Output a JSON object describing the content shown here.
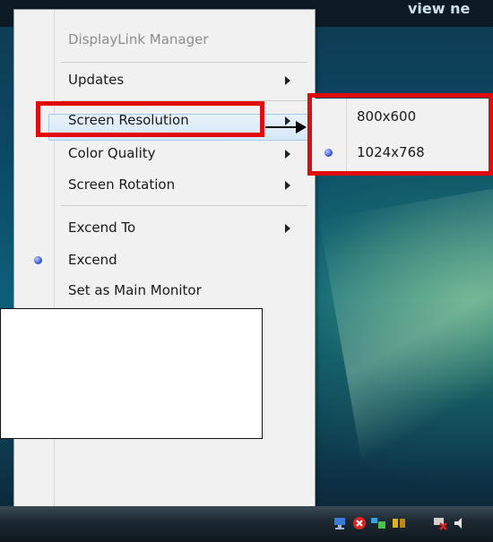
{
  "desktop": {
    "header_text": "view ne"
  },
  "menu": {
    "title": "DisplayLink Manager",
    "items": [
      {
        "label": "Updates",
        "has_submenu": true
      },
      {
        "label": "Screen Resolution",
        "has_submenu": true
      },
      {
        "label": "Color Quality",
        "has_submenu": true
      },
      {
        "label": "Screen Rotation",
        "has_submenu": true
      },
      {
        "label": "Excend To",
        "has_submenu": true
      },
      {
        "label": "Excend",
        "selected": true
      },
      {
        "label": "Set as Main Monitor"
      }
    ]
  },
  "submenu": {
    "options": [
      {
        "label": "800x600",
        "selected": false
      },
      {
        "label": "1024x768",
        "selected": true
      }
    ]
  },
  "colors": {
    "annotation_red": "#e10b0b",
    "menu_bg": "#f1f1f1",
    "highlight": "#d6e8f8"
  },
  "icons": [
    "network-icon",
    "security-alert-icon",
    "displaylink-icon",
    "sync-icon",
    "network-disconnected-icon",
    "volume-icon"
  ]
}
